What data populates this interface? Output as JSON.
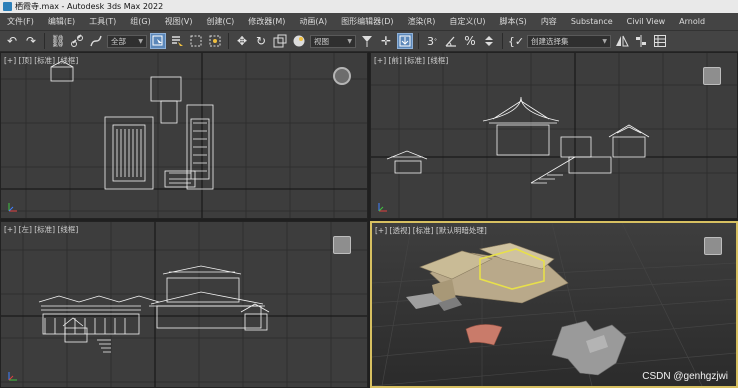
{
  "window": {
    "title": "栖霞寺.max - Autodesk 3ds Max 2022",
    "icon": "3dsmax-app-icon"
  },
  "menu": {
    "items": [
      "文件(F)",
      "编辑(E)",
      "工具(T)",
      "组(G)",
      "视图(V)",
      "创建(C)",
      "修改器(M)",
      "动画(A)",
      "图形编辑器(D)",
      "渲染(R)",
      "自定义(U)",
      "脚本(S)",
      "内容",
      "Substance",
      "Civil View",
      "Arnold"
    ]
  },
  "toolbar": {
    "filter_dropdown": "全部",
    "refcoord_dropdown": "视图",
    "selection_set_dropdown": "创建选择集"
  },
  "viewports": {
    "top": "[+] [顶] [标准] [线框]",
    "front": "[+] [前] [标准] [线框]",
    "left": "[+] [左] [标准] [线框]",
    "perspective": "[+] [透视] [标准] [默认明暗处理]"
  },
  "colors": {
    "selection_highlight": "#e8e04a",
    "active_viewport_border": "#d7c061",
    "roof_red": "#c97b6a",
    "building_tan": "#b9a98a"
  },
  "watermark": "CSDN @genhgzjwi"
}
